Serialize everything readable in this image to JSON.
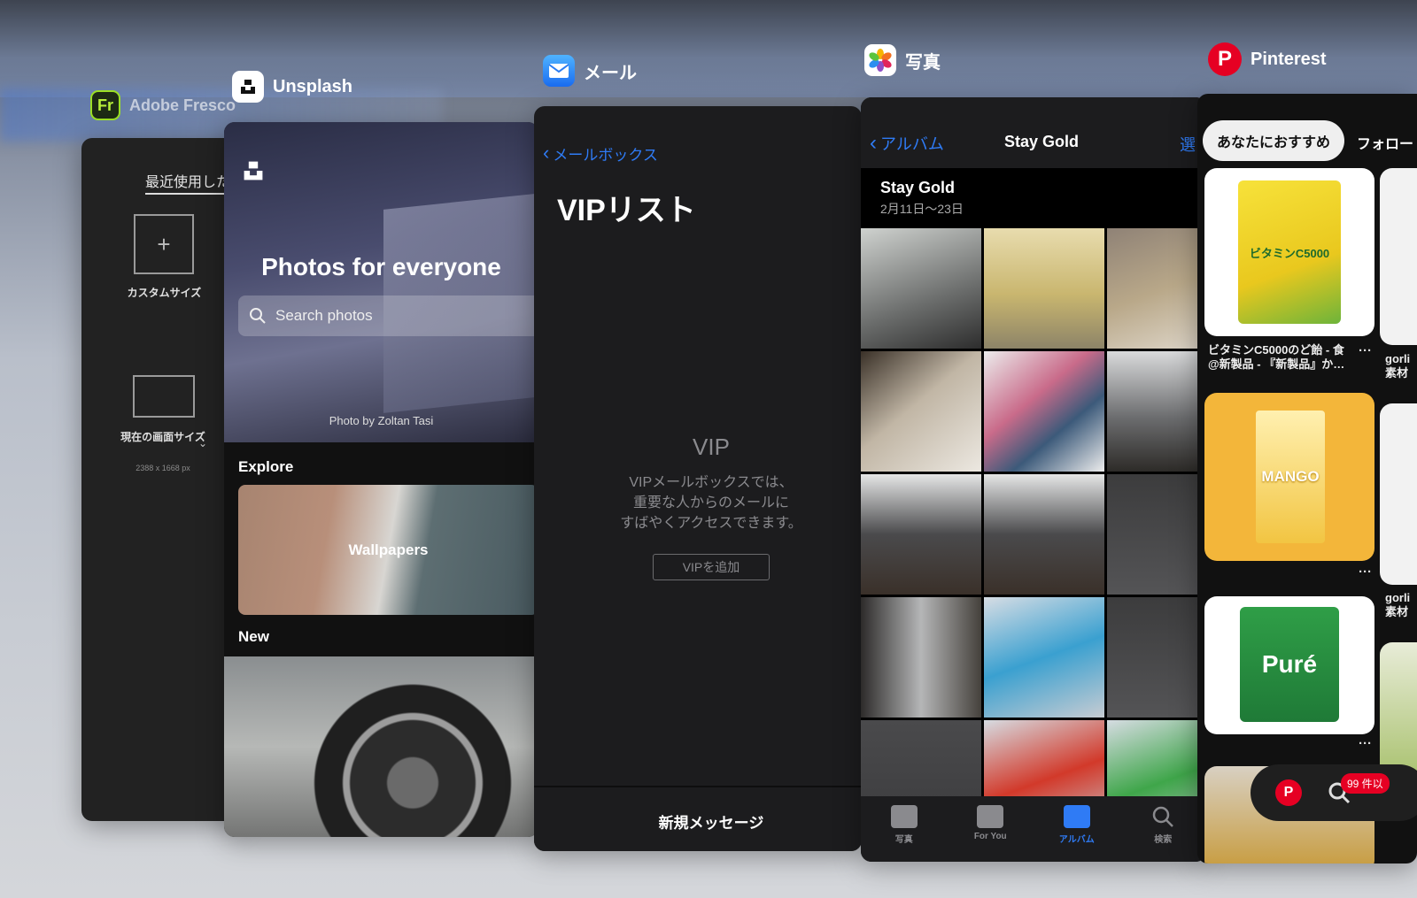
{
  "apps": {
    "fresco": {
      "name": "Adobe Fresco",
      "icon_text": "Fr",
      "recent_tab": "最近使用した",
      "custom_size": "カスタムサイズ",
      "current_size": "現在の画面サイズ",
      "current_dims": "2388 x 1668 px"
    },
    "unsplash": {
      "name": "Unsplash",
      "hero_title": "Photos for everyone",
      "search_placeholder": "Search photos",
      "credit": "Photo by Zoltan Tasi",
      "explore_label": "Explore",
      "wallpapers_label": "Wallpapers",
      "new_label": "New"
    },
    "mail": {
      "name": "メール",
      "back_label": "メールボックス",
      "title": "VIPリスト",
      "empty_title": "VIP",
      "empty_desc_1": "VIPメールボックスでは、",
      "empty_desc_2": "重要な人からのメールに",
      "empty_desc_3": "すばやくアクセスできます。",
      "add_vip": "VIPを追加",
      "new_message": "新規メッセージ"
    },
    "photos": {
      "name": "写真",
      "back_label": "アルバム",
      "nav_title": "Stay Gold",
      "select_label": "選",
      "album_title": "Stay Gold",
      "album_dates": "2月11日〜23日",
      "tabs": [
        {
          "label": "写真"
        },
        {
          "label": "For You"
        },
        {
          "label": "アルバム"
        },
        {
          "label": "検索"
        }
      ]
    },
    "pinterest": {
      "name": "Pinterest",
      "chip_label": "あなたにおすすめ",
      "follow_label": "フォロー",
      "pin1_caption_1": "ビタミンC5000のど飴 - 食",
      "pin1_caption_2": "@新製品 - 『新製品』か…",
      "pin1_text": "ビタミンC5000",
      "pin2_text": "MANGO",
      "pin3_text": "Puré",
      "side_caption_1": "gorli",
      "side_caption_2": "素材",
      "side_caption_3": "gorli",
      "side_caption_4": "素材",
      "badge": "99 件以"
    }
  }
}
